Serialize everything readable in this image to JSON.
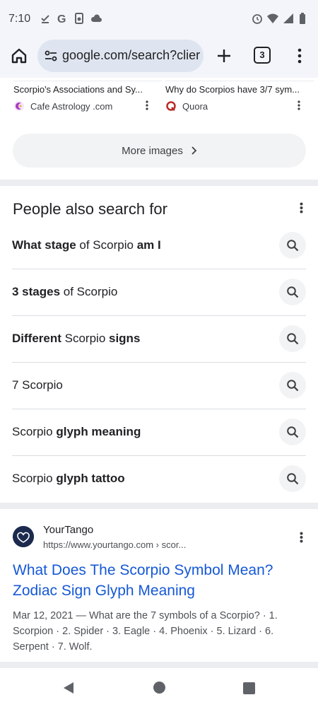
{
  "status_bar": {
    "time": "7:10",
    "left_icons": [
      "download-done-icon",
      "google-g-icon",
      "screenshot-icon",
      "cloud-icon"
    ],
    "right_icons": [
      "alarm-icon",
      "wifi-icon",
      "signal-icon",
      "battery-icon"
    ]
  },
  "toolbar": {
    "url": "google.com/search?clier",
    "tab_count": "3"
  },
  "image_cards": [
    {
      "caption": "Scorpio's Associations and Sy...",
      "source": "Cafe Astrology .com"
    },
    {
      "caption": "Why do Scorpios have 3/7 sym...",
      "source": "Quora"
    }
  ],
  "more_images": {
    "label": "More images"
  },
  "pasf": {
    "title": "People also search for",
    "items": [
      {
        "parts": [
          [
            "b",
            "What stage"
          ],
          [
            "n",
            " of Scorpio "
          ],
          [
            "b",
            "am I"
          ]
        ]
      },
      {
        "parts": [
          [
            "b",
            "3 stages"
          ],
          [
            "n",
            " of Scorpio"
          ]
        ]
      },
      {
        "parts": [
          [
            "b",
            "Different"
          ],
          [
            "n",
            " Scorpio "
          ],
          [
            "b",
            "signs"
          ]
        ]
      },
      {
        "parts": [
          [
            "n",
            "7 Scorpio"
          ]
        ]
      },
      {
        "parts": [
          [
            "n",
            "Scorpio "
          ],
          [
            "b",
            "glyph meaning"
          ]
        ]
      },
      {
        "parts": [
          [
            "n",
            "Scorpio "
          ],
          [
            "b",
            "glyph tattoo"
          ]
        ]
      }
    ]
  },
  "result": {
    "site_name": "YourTango",
    "url": "https://www.yourtango.com › scor...",
    "title": "What Does The Scorpio Symbol Mean? Zodiac Sign Glyph Meaning",
    "date": "Mar 12, 2021",
    "snippet": "What are the 7 symbols of a Scorpio? · 1. Scorpion · 2. Spider · 3. Eagle · 4. Phoenix · 5. Lizard · 6. Serpent · 7. Wolf."
  },
  "colors": {
    "link_blue": "#1558d6",
    "chrome_bg": "#f3f5fa",
    "omnibox_bg": "#dfe5f0"
  }
}
